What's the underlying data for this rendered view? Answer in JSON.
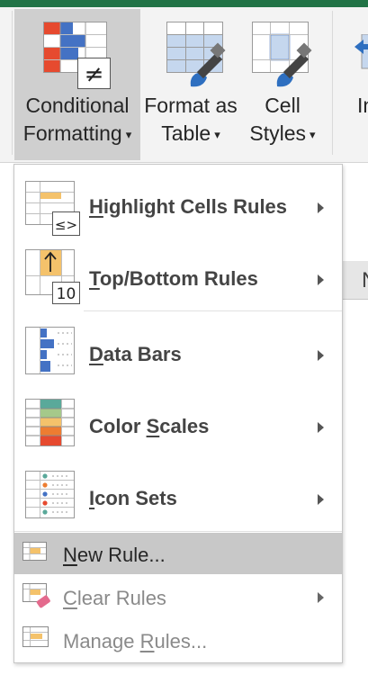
{
  "ribbon": {
    "buttons": [
      {
        "line1": "Conditional",
        "line2": "Formatting"
      },
      {
        "line1": "Format as",
        "line2": "Table"
      },
      {
        "line1": "Cell",
        "line2": "Styles"
      },
      {
        "line1": "In"
      }
    ]
  },
  "sheet": {
    "column_letter": "N"
  },
  "menu": {
    "items": [
      {
        "pre": "",
        "key": "H",
        "post": "ighlight Cells Rules",
        "icon_badge": "≤>"
      },
      {
        "pre": "",
        "key": "T",
        "post": "op/Bottom Rules",
        "icon_badge": "10"
      },
      {
        "pre": "",
        "key": "D",
        "post": "ata Bars"
      },
      {
        "pre": "Color ",
        "key": "S",
        "post": "cales"
      },
      {
        "pre": "",
        "key": "I",
        "post": "con Sets"
      },
      {
        "pre": "",
        "key": "N",
        "post": "ew Rule..."
      },
      {
        "pre": "",
        "key": "C",
        "post": "lear Rules"
      },
      {
        "pre": "Manage ",
        "key": "R",
        "post": "ules..."
      }
    ]
  },
  "colors": {
    "excel_green": "#217346",
    "accent_blue": "#4472c4",
    "accent_orange": "#ed7d31",
    "accent_red": "#e64a2f",
    "highlight_yellow": "#f4c26b",
    "menu_hover": "#c8c8c8"
  }
}
